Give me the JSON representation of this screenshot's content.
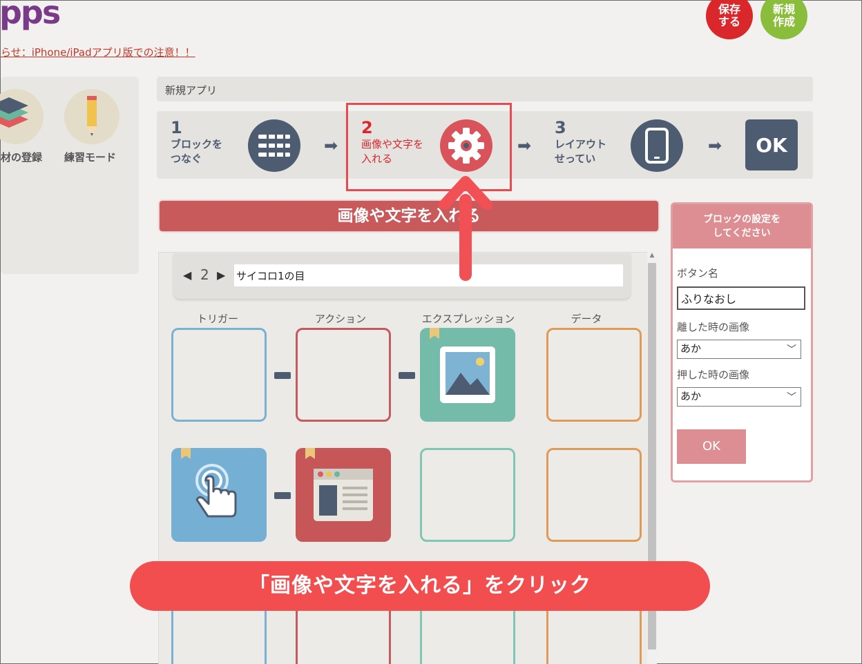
{
  "logo": {
    "text": "pps"
  },
  "notice_link": "らせ：iPhone/iPadアプリ版での注意！！",
  "top_buttons": {
    "save": "保存\nする",
    "new": "新規\n作成"
  },
  "left_menu": [
    {
      "label": "材の登録",
      "icon": "layers-icon"
    },
    {
      "label": "練習モード",
      "icon": "pencil-icon"
    }
  ],
  "breadcrumb": "新規アプリ",
  "steps": [
    {
      "num": "1",
      "label": "ブロックを\nつなぐ",
      "icon": "blocks-icon"
    },
    {
      "num": "2",
      "label": "画像や文字を\n入れる",
      "icon": "gear-icon",
      "active": true
    },
    {
      "num": "3",
      "label": "レイアウト\nせってい",
      "icon": "smartphone-icon"
    },
    {
      "num": "",
      "label": "OK",
      "icon": "ok-icon"
    }
  ],
  "section_title": "画像や文字を入れる",
  "block_nav": {
    "prev": "◀",
    "page": "2",
    "next": "▶",
    "name_value": "サイコロ1の目"
  },
  "columns": [
    "トリガー",
    "アクション",
    "エクスプレッション",
    "データ"
  ],
  "settings": {
    "title": "ブロックの設定を\nしてください",
    "button_name_label": "ボタン名",
    "button_name_value": "ふりなおし",
    "release_image_label": "離した時の画像",
    "release_image_value": "あか",
    "press_image_label": "押した時の画像",
    "press_image_value": "あか",
    "ok_label": "OK"
  },
  "callout": "「画像や文字を入れる」をクリック",
  "colors": {
    "accent_red": "#e84a50",
    "navy": "#4d5c70",
    "trigger": "#7ab1d3",
    "action": "#c45a5d",
    "expression": "#7ec7b4",
    "data": "#e09a58"
  }
}
